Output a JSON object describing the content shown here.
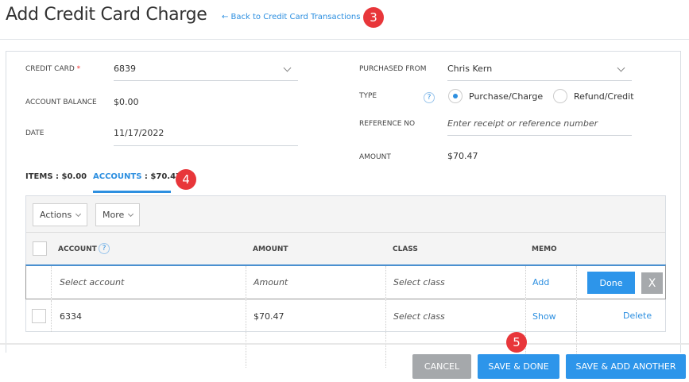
{
  "header": {
    "title": "Add Credit Card Charge",
    "back_link": "← Back to Credit Card Transactions"
  },
  "annotations": [
    "3",
    "4",
    "5"
  ],
  "form": {
    "credit_card": {
      "label": "CREDIT CARD",
      "required": "*",
      "value": "6839"
    },
    "account_balance": {
      "label": "ACCOUNT BALANCE",
      "value": "$0.00"
    },
    "date": {
      "label": "DATE",
      "value": "11/17/2022"
    },
    "purchased_from": {
      "label": "PURCHASED FROM",
      "value": "Chris Kern"
    },
    "type": {
      "label": "TYPE",
      "help": "?",
      "options": [
        "Purchase/Charge",
        "Refund/Credit"
      ],
      "selected": "Purchase/Charge"
    },
    "reference_no": {
      "label": "REFERENCE NO",
      "placeholder": "Enter receipt or reference number"
    },
    "amount": {
      "label": "AMOUNT",
      "value": "$70.47"
    }
  },
  "tabs": {
    "items": "ITEMS",
    "items_value": " : $0.00",
    "accounts": "ACCOUNTS",
    "accounts_value": " : $70.47"
  },
  "toolbar": {
    "actions": "Actions",
    "more": "More"
  },
  "table": {
    "columns": {
      "account": "ACCOUNT",
      "help": "?",
      "amount": "AMOUNT",
      "class": "CLASS",
      "memo": "MEMO"
    },
    "edit_row": {
      "account": "Select account",
      "amount": "Amount",
      "class": "Select class",
      "memo": "Add",
      "done": "Done",
      "close": "X"
    },
    "rows": [
      {
        "account": "6334",
        "amount": "$70.47",
        "class": "Select class",
        "memo": "Show",
        "delete": "Delete"
      }
    ]
  },
  "footer": {
    "cancel": "CANCEL",
    "save_done": "SAVE & DONE",
    "save_add": "SAVE & ADD ANOTHER"
  },
  "colors": {
    "accent": "#2d8fe0",
    "badge": "#e8363a",
    "cancel": "#a5a8ab"
  }
}
